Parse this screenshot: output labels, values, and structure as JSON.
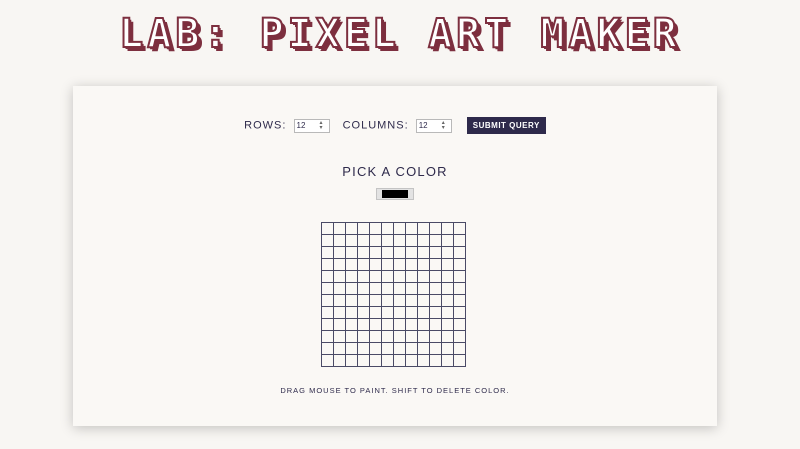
{
  "header": {
    "title": "LAB: PIXEL ART MAKER"
  },
  "form": {
    "rows_label": "ROWS:",
    "rows_value": "12",
    "columns_label": "COLUMNS:",
    "columns_value": "12",
    "submit_label": "SUBMIT QUERY"
  },
  "picker": {
    "heading": "PICK A COLOR",
    "selected_color": "#000000"
  },
  "canvas": {
    "rows": 12,
    "columns": 12,
    "grid_line_color": "#4a4a66"
  },
  "instructions": "DRAG MOUSE TO PAINT. SHIFT TO DELETE COLOR.",
  "colors": {
    "title_accent": "#7d2f3f",
    "button_bg": "#2e2a4b",
    "page_bg": "#f8f6f3"
  }
}
